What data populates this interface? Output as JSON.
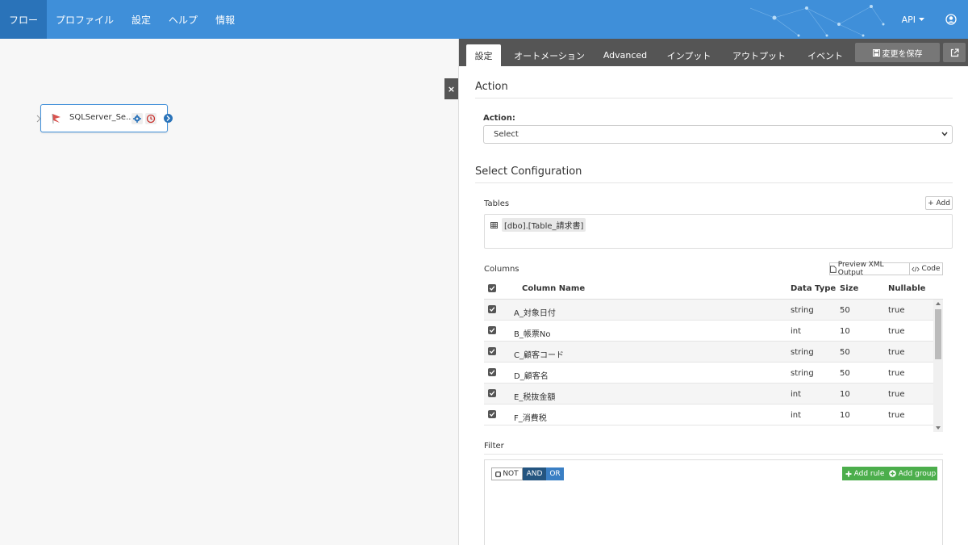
{
  "nav": {
    "items": [
      "フロー",
      "プロファイル",
      "設定",
      "ヘルプ",
      "情報"
    ],
    "api_label": "API"
  },
  "canvas": {
    "node_label": "SQLServer_Se...",
    "close_label": "×"
  },
  "panel": {
    "tabs": [
      "設定",
      "オートメーション",
      "Advanced",
      "インプット",
      "アウトプット",
      "イベント"
    ],
    "save_label": "変更を保存",
    "action_title": "Action",
    "action_label": "Action:",
    "action_value": "Select",
    "select_config_title": "Select Configuration",
    "tables_label": "Tables",
    "add_label": "+ Add",
    "table_name": "[dbo].[Table_請求書]",
    "columns_label": "Columns",
    "preview_label": "Preview XML Output",
    "code_label": "Code",
    "column_headers": {
      "name": "Column Name",
      "type": "Data Type",
      "size": "Size",
      "nullable": "Nullable"
    },
    "rows": [
      {
        "name": "A_対象日付",
        "type": "string",
        "size": "50",
        "nullable": "true"
      },
      {
        "name": "B_帳票No",
        "type": "int",
        "size": "10",
        "nullable": "true"
      },
      {
        "name": "C_顧客コード",
        "type": "string",
        "size": "50",
        "nullable": "true"
      },
      {
        "name": "D_顧客名",
        "type": "string",
        "size": "50",
        "nullable": "true"
      },
      {
        "name": "E_税抜金額",
        "type": "int",
        "size": "10",
        "nullable": "true"
      },
      {
        "name": "F_消費税",
        "type": "int",
        "size": "10",
        "nullable": "true"
      }
    ],
    "filter_label": "Filter",
    "not_label": "NOT",
    "and_label": "AND",
    "or_label": "OR",
    "add_rule_label": "Add rule",
    "add_group_label": "Add group"
  },
  "colors": {
    "nav_bg": "#3f8fd9",
    "nav_active": "#2a73b9",
    "tab_bar": "#555555",
    "green": "#4cae4c"
  }
}
